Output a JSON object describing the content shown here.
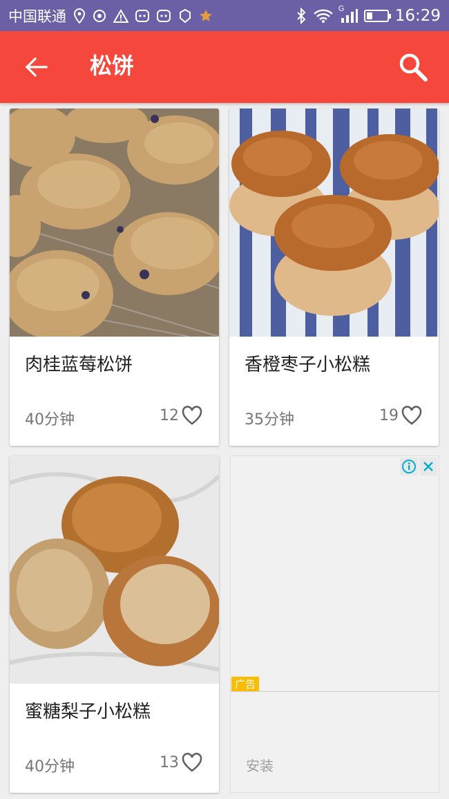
{
  "status_bar": {
    "carrier": "中国联通",
    "network_type": "G",
    "time": "16:29",
    "battery_level": 0.3,
    "icons": [
      "location-icon",
      "hotspot-icon",
      "warning-icon",
      "notification-icon",
      "notification-icon",
      "hand-icon",
      "star-icon",
      "bluetooth-icon",
      "wifi-icon",
      "signal-icon",
      "battery-icon"
    ]
  },
  "app_bar": {
    "title": "松饼",
    "background": "#f5473b",
    "back_icon": "arrow-left-icon",
    "search_icon": "search-icon"
  },
  "recipes": [
    {
      "name": "肉桂蓝莓松饼",
      "time": "40分钟",
      "likes": "12",
      "image": "muffin-photo"
    },
    {
      "name": "香橙枣子小松糕",
      "time": "35分钟",
      "likes": "19",
      "image": "muffin-photo"
    },
    {
      "name": "蜜糖梨子小松糕",
      "time": "40分钟",
      "likes": "13",
      "image": "muffin-photo"
    }
  ],
  "ad": {
    "label": "广告",
    "install": "安装",
    "info_icon": "info-icon",
    "close_icon": "close-icon"
  }
}
